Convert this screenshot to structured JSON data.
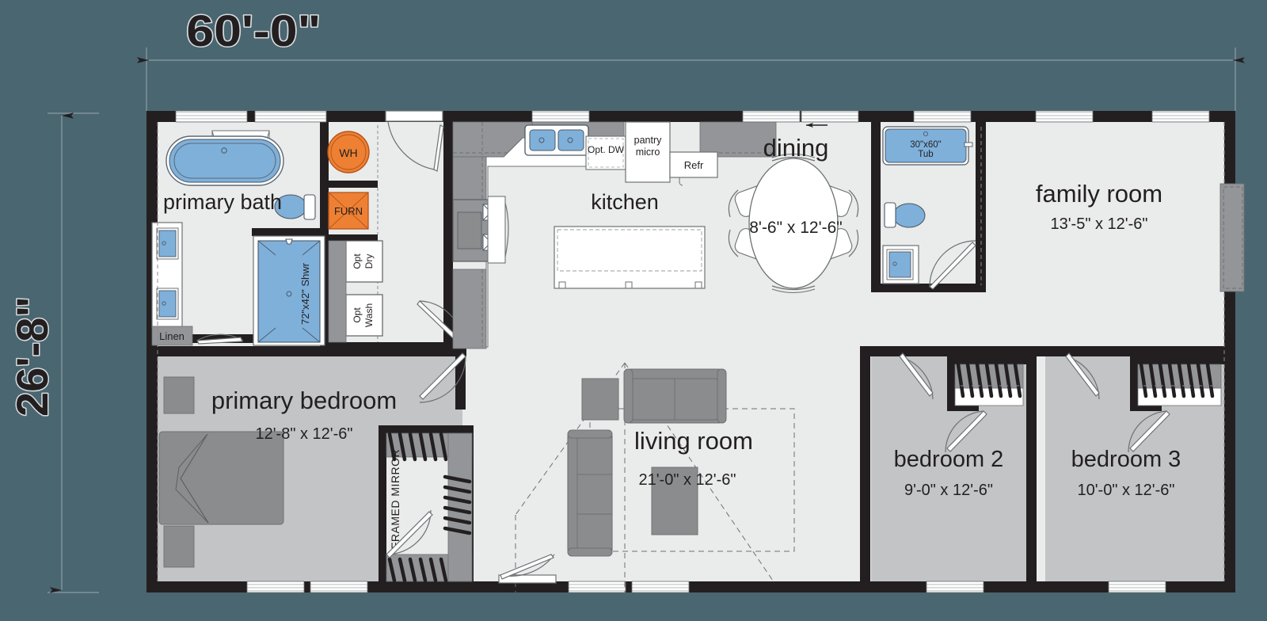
{
  "plan": {
    "background_color": "#4a6671",
    "wall_color": "#231f20",
    "living_fill": "#eaebeb",
    "bedroom_fill": "#c2c4c6",
    "cabinet_fill": "#939598",
    "water_fill": "#7fb0da",
    "appliance_fill": "#ed8033",
    "furniture_fill": "#8a8c8e",
    "overall_dimensions": {
      "width_label": "60'-0\"",
      "height_label": "26'-8\""
    }
  },
  "rooms": [
    {
      "id": "primary-bath",
      "name": "primary bath",
      "dim": ""
    },
    {
      "id": "kitchen",
      "name": "kitchen",
      "dim": ""
    },
    {
      "id": "dining",
      "name": "dining",
      "dim": "8'-6\" x 12'-6\""
    },
    {
      "id": "family-room",
      "name": "family room",
      "dim": "13'-5\" x 12'-6\""
    },
    {
      "id": "primary-bedroom",
      "name": "primary bedroom",
      "dim": "12'-8\" x 12'-6\""
    },
    {
      "id": "living-room",
      "name": "living room",
      "dim": "21'-0\" x 12'-6\""
    },
    {
      "id": "bedroom-2",
      "name": "bedroom 2",
      "dim": "9'-0\" x 12'-6\""
    },
    {
      "id": "bedroom-3",
      "name": "bedroom 3",
      "dim": "10'-0\" x 12'-6\""
    }
  ],
  "labels": {
    "water_heater": "WH",
    "furnace": "FURN",
    "opt_dryer_line1": "Opt",
    "opt_dryer_line2": "Dry",
    "opt_washer_line1": "Opt",
    "opt_washer_line2": "Wash",
    "linen": "Linen",
    "shower": "72\"x42\" Shwr",
    "framed_mirror": "FRAMED MIRROR",
    "opt_dishwasher": "Opt. DW",
    "pantry_line1": "pantry",
    "pantry_line2": "micro",
    "refrigerator": "Refr",
    "tub_line1": "30\"x60\"",
    "tub_line2": "Tub"
  },
  "fixtures": {
    "primary_tub": "oval-garden-tub",
    "primary_toilet": "toilet",
    "primary_vanity_sinks": 2,
    "primary_shower": "shower-pan",
    "bath2_tub": "alcove-tub",
    "bath2_toilet": "toilet",
    "bath2_vanity_sinks": 1,
    "kitchen_sink_bowls": 2,
    "range": "cooktop-range",
    "dining_chairs": 6,
    "bedroom_closets": 3
  }
}
